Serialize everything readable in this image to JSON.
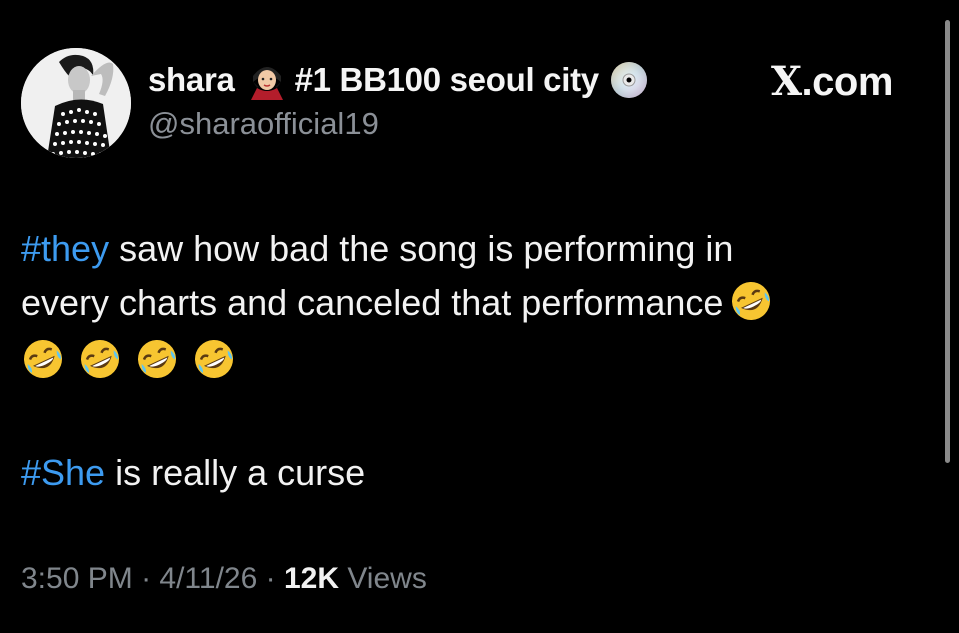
{
  "author": {
    "display_name": "shara",
    "name_emoji": "vampire-woman-emoji",
    "badge_text": "#1 BB100 seoul city",
    "badge_icon": "cd-disc-icon",
    "handle": "@sharaofficial19"
  },
  "site_label": {
    "x": "X",
    "rest": ".com"
  },
  "tweet": {
    "line1_hashtag": "#they",
    "line1_text": " saw how bad the song is performing in",
    "line2_text": "every charts and canceled that performance",
    "emoji": "rolling-on-the-floor-laughing-emoji",
    "line3_hashtag": "#She",
    "line3_text": " is really a curse"
  },
  "meta": {
    "time": "3:50 PM",
    "sep1": " · ",
    "date": "4/11/26",
    "sep2": " · ",
    "views_count": "12K",
    "views_label": " Views"
  },
  "colors": {
    "background": "#000000",
    "hashtag": "#3d9bf0",
    "muted": "#80868c",
    "text": "#f2f2f2"
  }
}
